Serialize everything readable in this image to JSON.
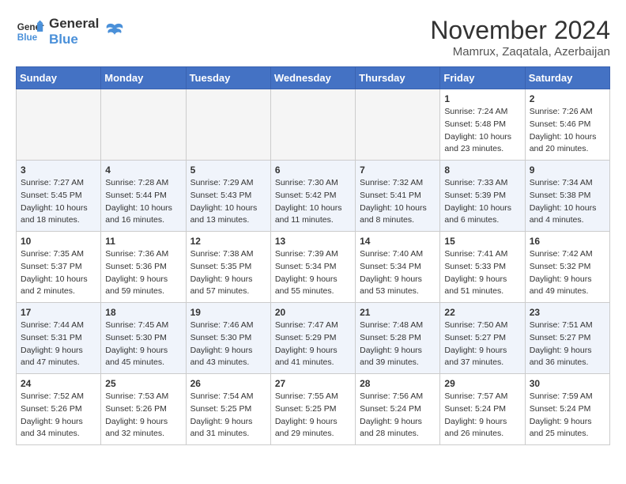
{
  "logo": {
    "line1": "General",
    "line2": "Blue"
  },
  "title": "November 2024",
  "location": "Mamrux, Zaqatala, Azerbaijan",
  "days_of_week": [
    "Sunday",
    "Monday",
    "Tuesday",
    "Wednesday",
    "Thursday",
    "Friday",
    "Saturday"
  ],
  "weeks": [
    [
      {
        "day": "",
        "empty": true
      },
      {
        "day": "",
        "empty": true
      },
      {
        "day": "",
        "empty": true
      },
      {
        "day": "",
        "empty": true
      },
      {
        "day": "",
        "empty": true
      },
      {
        "day": "1",
        "sunrise": "7:24 AM",
        "sunset": "5:48 PM",
        "daylight": "10 hours and 23 minutes."
      },
      {
        "day": "2",
        "sunrise": "7:26 AM",
        "sunset": "5:46 PM",
        "daylight": "10 hours and 20 minutes."
      }
    ],
    [
      {
        "day": "3",
        "sunrise": "7:27 AM",
        "sunset": "5:45 PM",
        "daylight": "10 hours and 18 minutes."
      },
      {
        "day": "4",
        "sunrise": "7:28 AM",
        "sunset": "5:44 PM",
        "daylight": "10 hours and 16 minutes."
      },
      {
        "day": "5",
        "sunrise": "7:29 AM",
        "sunset": "5:43 PM",
        "daylight": "10 hours and 13 minutes."
      },
      {
        "day": "6",
        "sunrise": "7:30 AM",
        "sunset": "5:42 PM",
        "daylight": "10 hours and 11 minutes."
      },
      {
        "day": "7",
        "sunrise": "7:32 AM",
        "sunset": "5:41 PM",
        "daylight": "10 hours and 8 minutes."
      },
      {
        "day": "8",
        "sunrise": "7:33 AM",
        "sunset": "5:39 PM",
        "daylight": "10 hours and 6 minutes."
      },
      {
        "day": "9",
        "sunrise": "7:34 AM",
        "sunset": "5:38 PM",
        "daylight": "10 hours and 4 minutes."
      }
    ],
    [
      {
        "day": "10",
        "sunrise": "7:35 AM",
        "sunset": "5:37 PM",
        "daylight": "10 hours and 2 minutes."
      },
      {
        "day": "11",
        "sunrise": "7:36 AM",
        "sunset": "5:36 PM",
        "daylight": "9 hours and 59 minutes."
      },
      {
        "day": "12",
        "sunrise": "7:38 AM",
        "sunset": "5:35 PM",
        "daylight": "9 hours and 57 minutes."
      },
      {
        "day": "13",
        "sunrise": "7:39 AM",
        "sunset": "5:34 PM",
        "daylight": "9 hours and 55 minutes."
      },
      {
        "day": "14",
        "sunrise": "7:40 AM",
        "sunset": "5:34 PM",
        "daylight": "9 hours and 53 minutes."
      },
      {
        "day": "15",
        "sunrise": "7:41 AM",
        "sunset": "5:33 PM",
        "daylight": "9 hours and 51 minutes."
      },
      {
        "day": "16",
        "sunrise": "7:42 AM",
        "sunset": "5:32 PM",
        "daylight": "9 hours and 49 minutes."
      }
    ],
    [
      {
        "day": "17",
        "sunrise": "7:44 AM",
        "sunset": "5:31 PM",
        "daylight": "9 hours and 47 minutes."
      },
      {
        "day": "18",
        "sunrise": "7:45 AM",
        "sunset": "5:30 PM",
        "daylight": "9 hours and 45 minutes."
      },
      {
        "day": "19",
        "sunrise": "7:46 AM",
        "sunset": "5:30 PM",
        "daylight": "9 hours and 43 minutes."
      },
      {
        "day": "20",
        "sunrise": "7:47 AM",
        "sunset": "5:29 PM",
        "daylight": "9 hours and 41 minutes."
      },
      {
        "day": "21",
        "sunrise": "7:48 AM",
        "sunset": "5:28 PM",
        "daylight": "9 hours and 39 minutes."
      },
      {
        "day": "22",
        "sunrise": "7:50 AM",
        "sunset": "5:27 PM",
        "daylight": "9 hours and 37 minutes."
      },
      {
        "day": "23",
        "sunrise": "7:51 AM",
        "sunset": "5:27 PM",
        "daylight": "9 hours and 36 minutes."
      }
    ],
    [
      {
        "day": "24",
        "sunrise": "7:52 AM",
        "sunset": "5:26 PM",
        "daylight": "9 hours and 34 minutes."
      },
      {
        "day": "25",
        "sunrise": "7:53 AM",
        "sunset": "5:26 PM",
        "daylight": "9 hours and 32 minutes."
      },
      {
        "day": "26",
        "sunrise": "7:54 AM",
        "sunset": "5:25 PM",
        "daylight": "9 hours and 31 minutes."
      },
      {
        "day": "27",
        "sunrise": "7:55 AM",
        "sunset": "5:25 PM",
        "daylight": "9 hours and 29 minutes."
      },
      {
        "day": "28",
        "sunrise": "7:56 AM",
        "sunset": "5:24 PM",
        "daylight": "9 hours and 28 minutes."
      },
      {
        "day": "29",
        "sunrise": "7:57 AM",
        "sunset": "5:24 PM",
        "daylight": "9 hours and 26 minutes."
      },
      {
        "day": "30",
        "sunrise": "7:59 AM",
        "sunset": "5:24 PM",
        "daylight": "9 hours and 25 minutes."
      }
    ]
  ],
  "labels": {
    "sunrise": "Sunrise:",
    "sunset": "Sunset:",
    "daylight": "Daylight:"
  }
}
